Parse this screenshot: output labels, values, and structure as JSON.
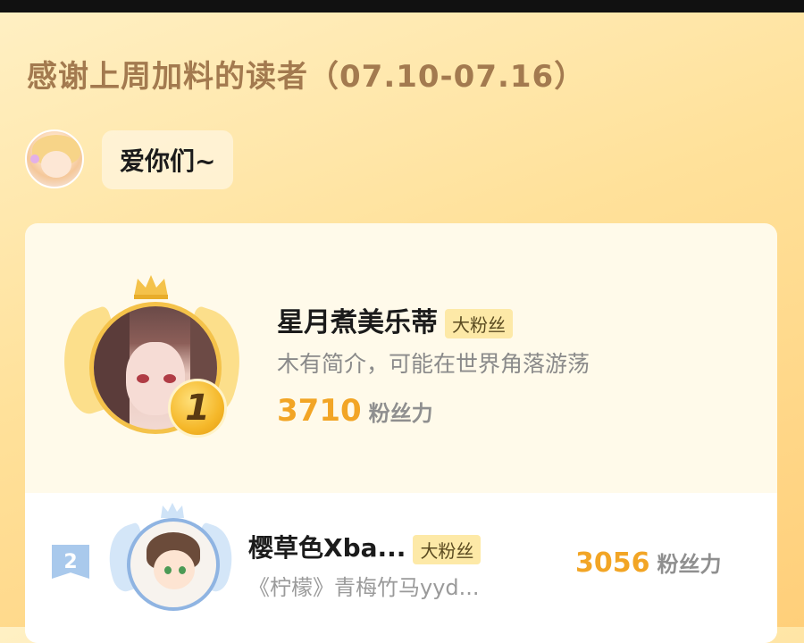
{
  "title": "感谢上周加料的读者（07.10-07.16）",
  "message": {
    "text": "爱你们~"
  },
  "rankings": [
    {
      "rank": "1",
      "name": "星月煮美乐蒂",
      "tag": "大粉丝",
      "bio": "木有简介，可能在世界角落游荡",
      "score": "3710",
      "score_label": "粉丝力"
    },
    {
      "rank": "2",
      "name": "樱草色Xba...",
      "tag": "大粉丝",
      "bio": "《柠檬》青梅竹马yyd...",
      "score": "3056",
      "score_label": "粉丝力"
    }
  ],
  "colors": {
    "accent_gold": "#f2a525",
    "title_brown": "#a37a4f",
    "rank2_blue": "#a9c9ec"
  }
}
